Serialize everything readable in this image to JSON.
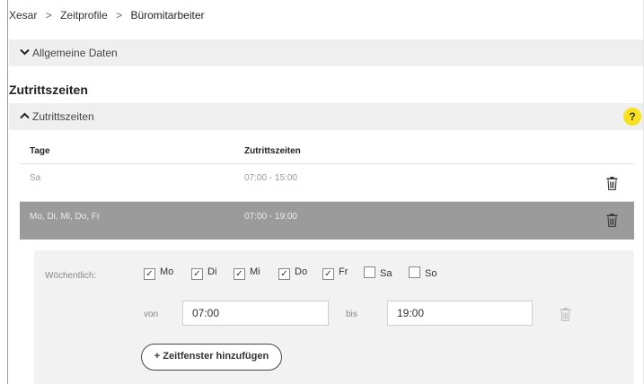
{
  "breadcrumb": {
    "root": "Xesar",
    "parent": "Zeitprofile",
    "current": "Büromitarbeiter",
    "separator": ">"
  },
  "sections": {
    "allgemeine_daten": {
      "label": "Allgemeine Daten",
      "expanded": false
    },
    "title": "Zutrittszeiten",
    "zutrittszeiten": {
      "label": "Zutrittszeiten",
      "expanded": true,
      "help_label": "?"
    }
  },
  "table": {
    "headers": {
      "days": "Tage",
      "times": "Zutrittszeiten"
    },
    "rows": [
      {
        "days": "Sa",
        "times": "07:00 - 15:00",
        "selected": false
      },
      {
        "days": "Mo, Di, Mi, Do, Fr",
        "times": "07:00 - 19:00",
        "selected": true
      }
    ]
  },
  "editor": {
    "weekly_label": "Wöchentlich:",
    "days": [
      {
        "label": "Mo",
        "checked": true,
        "mark": "✓"
      },
      {
        "label": "Di",
        "checked": true,
        "mark": "✓"
      },
      {
        "label": "Mi",
        "checked": true,
        "mark": "✓"
      },
      {
        "label": "Do",
        "checked": true,
        "mark": "✓"
      },
      {
        "label": "Fr",
        "checked": true,
        "mark": "✓"
      },
      {
        "label": "Sa",
        "checked": false,
        "mark": ""
      },
      {
        "label": "So",
        "checked": false,
        "mark": ""
      }
    ],
    "from_label": "von",
    "from_value": "07:00",
    "to_label": "bis",
    "to_value": "19:00",
    "add_button_label": "+ Zeitfenster hinzufügen"
  },
  "colors": {
    "accent_help": "#f7e11c",
    "selected_row": "#9b9b9b",
    "section_bar": "#efefef",
    "editor_bg": "#f2f2f2"
  },
  "icons": {
    "caret_collapsed": "chevron-down-icon",
    "caret_expanded": "chevron-up-icon",
    "delete": "trash-icon"
  }
}
